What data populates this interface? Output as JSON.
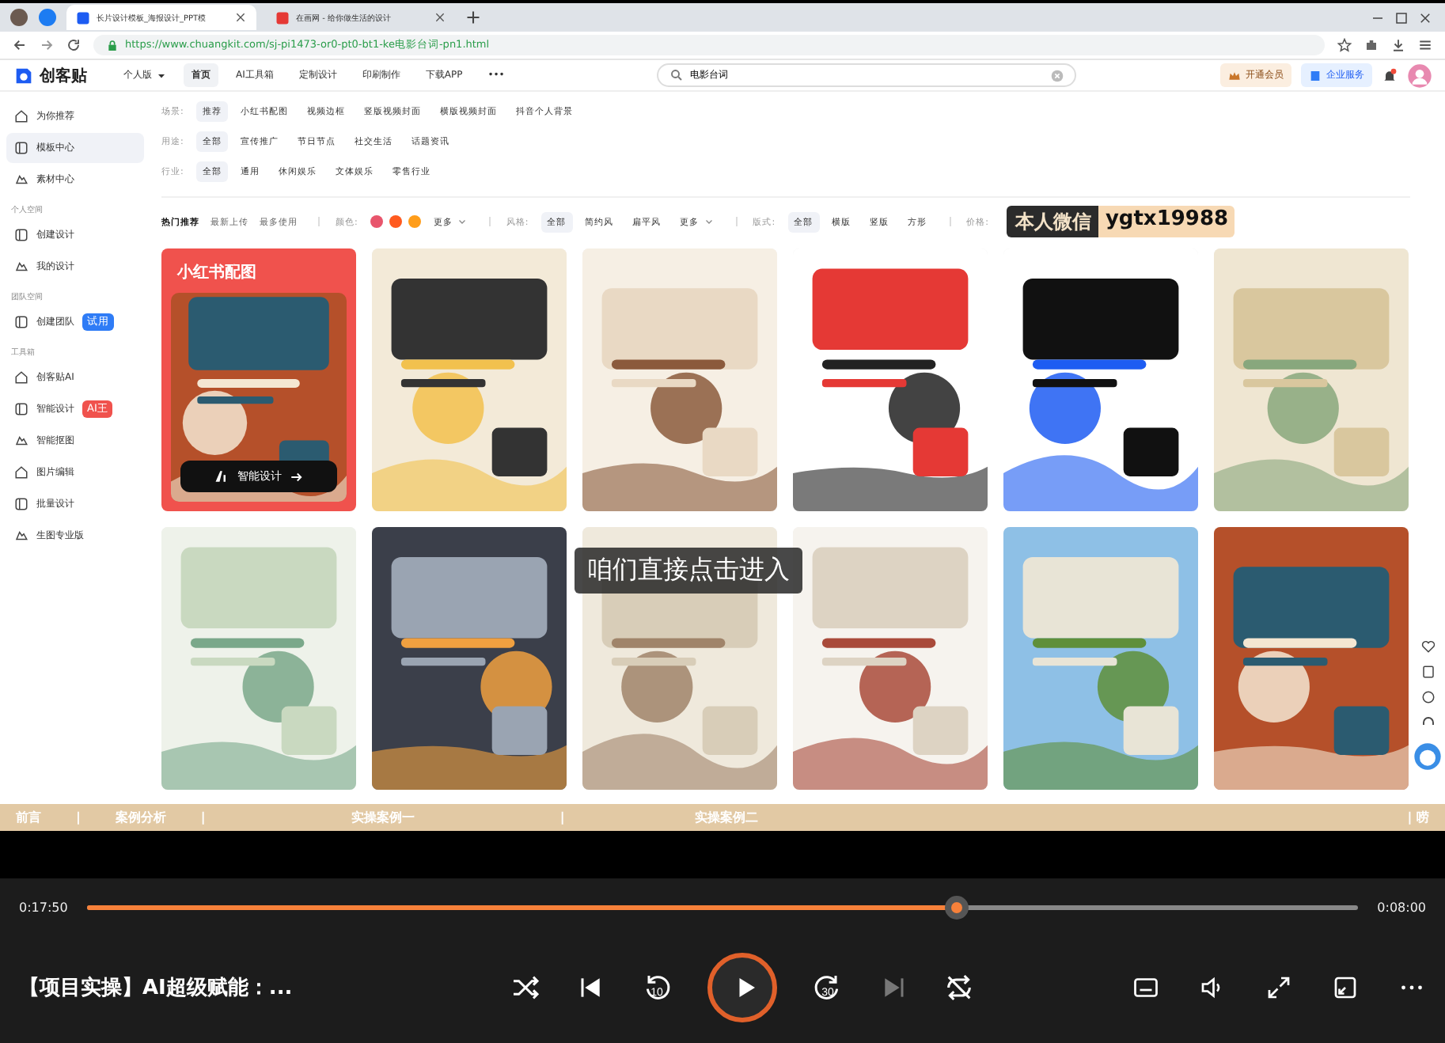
{
  "browser": {
    "tabs": [
      {
        "title": "长片设计模板_海报设计_PPT模",
        "selected": true
      },
      {
        "title": "在画网 - 给你做生活的设计",
        "selected": false
      }
    ],
    "url": "https://www.chuangkit.com/sj-pi1473-or0-pt0-bt1-ke电影台词-pn1.html"
  },
  "site": {
    "logo": "创客贴",
    "edition": "个人版",
    "nav": [
      {
        "label": "首页",
        "selected": true
      },
      {
        "label": "AI工具箱",
        "selected": false
      },
      {
        "label": "定制设计",
        "selected": false
      },
      {
        "label": "印刷制作",
        "selected": false
      },
      {
        "label": "下载APP",
        "selected": false
      },
      {
        "label": "•••",
        "selected": false
      }
    ],
    "search": "电影台词",
    "vip": "开通会员",
    "enterprise": "企业服务"
  },
  "sidebar": [
    {
      "kind": "item",
      "label": "为你推荐",
      "selected": false
    },
    {
      "kind": "item",
      "label": "模板中心",
      "selected": true
    },
    {
      "kind": "item",
      "label": "素材中心",
      "selected": false
    },
    {
      "kind": "section",
      "label": "个人空间"
    },
    {
      "kind": "item",
      "label": "创建设计",
      "selected": false
    },
    {
      "kind": "item",
      "label": "我的设计",
      "selected": false
    },
    {
      "kind": "section",
      "label": "团队空间"
    },
    {
      "kind": "item",
      "label": "创建团队",
      "selected": false,
      "badge": "试用",
      "color": "#2f7cf6"
    },
    {
      "kind": "section",
      "label": "工具箱"
    },
    {
      "kind": "item",
      "label": "创客贴AI",
      "selected": false
    },
    {
      "kind": "item",
      "label": "智能设计",
      "selected": false,
      "badge": "AI王",
      "color": "#f0524d"
    },
    {
      "kind": "item",
      "label": "智能抠图",
      "selected": false
    },
    {
      "kind": "item",
      "label": "图片编辑",
      "selected": false
    },
    {
      "kind": "item",
      "label": "批量设计",
      "selected": false
    },
    {
      "kind": "item",
      "label": "生图专业版",
      "selected": false
    }
  ],
  "filters": [
    {
      "label": "场景:",
      "options": [
        {
          "label": "推荐",
          "selected": true
        },
        {
          "label": "小红书配图",
          "selected": false
        },
        {
          "label": "视频边框",
          "selected": false
        },
        {
          "label": "竖版视频封面",
          "selected": false
        },
        {
          "label": "横版视频封面",
          "selected": false
        },
        {
          "label": "抖音个人背景",
          "selected": false
        }
      ]
    },
    {
      "label": "用途:",
      "options": [
        {
          "label": "全部",
          "selected": true
        },
        {
          "label": "宣传推广",
          "selected": false
        },
        {
          "label": "节日节点",
          "selected": false
        },
        {
          "label": "社交生活",
          "selected": false
        },
        {
          "label": "话题资讯",
          "selected": false
        }
      ]
    },
    {
      "label": "行业:",
      "options": [
        {
          "label": "全部",
          "selected": true
        },
        {
          "label": "通用",
          "selected": false
        },
        {
          "label": "休闲娱乐",
          "selected": false
        },
        {
          "label": "文体娱乐",
          "selected": false
        },
        {
          "label": "零售行业",
          "selected": false
        }
      ]
    }
  ],
  "sort": [
    {
      "label": "热门推荐",
      "selected": true
    },
    {
      "label": "最新上传",
      "selected": false
    },
    {
      "label": "最多使用",
      "selected": false
    }
  ],
  "color_filter": {
    "label": "颜色:",
    "colors": [
      {
        "color": "#e8556c"
      },
      {
        "color": "#ff5a1f"
      },
      {
        "color": "#ff9d1a"
      }
    ],
    "more": "更多"
  },
  "style_filter": {
    "label": "风格:",
    "options": [
      {
        "label": "全部",
        "selected": true
      },
      {
        "label": "简约风",
        "selected": false
      },
      {
        "label": "扁平风",
        "selected": false
      }
    ],
    "more": "更多"
  },
  "layout_filter": {
    "label": "版式:",
    "options": [
      {
        "label": "全部",
        "selected": true
      },
      {
        "label": "横版",
        "selected": false
      },
      {
        "label": "竖版",
        "selected": false
      },
      {
        "label": "方形",
        "selected": false
      }
    ]
  },
  "price_filter": {
    "label": "价格:"
  },
  "cards": [
    {
      "kind": "promo",
      "title": "小红书配图",
      "button": "智能设计"
    },
    {
      "kind": "picture"
    },
    {
      "kind": "picture"
    },
    {
      "kind": "picture"
    },
    {
      "kind": "picture"
    },
    {
      "kind": "picture"
    },
    {
      "kind": "picture"
    },
    {
      "kind": "picture"
    },
    {
      "kind": "picture"
    },
    {
      "kind": "picture"
    },
    {
      "kind": "picture"
    },
    {
      "kind": "picture"
    }
  ],
  "overlays": {
    "contact_label": "本人微信",
    "contact_id": "ygtx19988",
    "subtitle": "咱们直接点击进入"
  },
  "chapters": [
    "前言",
    "|",
    "案例分析",
    "|",
    "实操案例一",
    "|",
    "实操案例二",
    "| 唠"
  ],
  "player": {
    "elapsed": "0:17:50",
    "remaining": "0:08:00",
    "level": 0.684,
    "title": "【项目实操】AI超级赋能：...",
    "rewind": "10",
    "forward": "30",
    "playing": false
  }
}
